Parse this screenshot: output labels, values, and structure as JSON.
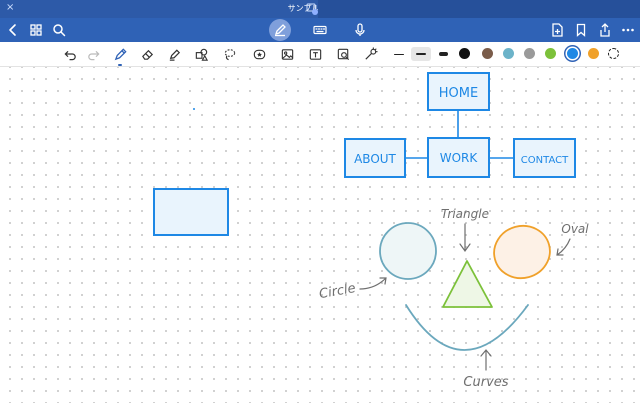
{
  "titlebar": {
    "close": "×",
    "title": "サンプルノート",
    "chevron": "⌄"
  },
  "navbar": {
    "icons": [
      "back-icon",
      "grid-icon",
      "search-icon",
      "pen-icon",
      "keyboard-icon",
      "microphone-icon",
      "add-page-icon",
      "bookmark-icon",
      "share-icon",
      "more-icon"
    ]
  },
  "toolbar": {
    "tools": [
      "undo-icon",
      "redo-icon",
      "pen-tool-icon",
      "eraser-icon",
      "highlighter-icon",
      "shapes-icon",
      "lasso-icon",
      "sticker-icon",
      "image-icon",
      "textbox-icon",
      "zoom-window-icon",
      "laser-pointer-icon"
    ],
    "colors": [
      "#111111",
      "#7a5c4a",
      "#6cb3c9",
      "#9a9a9a",
      "#7cc13a",
      "#1e88e5",
      "#f0a12a"
    ],
    "selected_color": "#1e88e5"
  },
  "canvas": {
    "nodes": {
      "home": "HOME",
      "work": "WORK",
      "about": "ABOUT",
      "contact": "CONTACT"
    },
    "annotations": {
      "triangle": "Triangle",
      "oval": "Oval",
      "circle": "Circle",
      "curves": "Curves"
    },
    "stroke_blue": "#1e88e5",
    "fill_blue": "#e9f4fd"
  }
}
